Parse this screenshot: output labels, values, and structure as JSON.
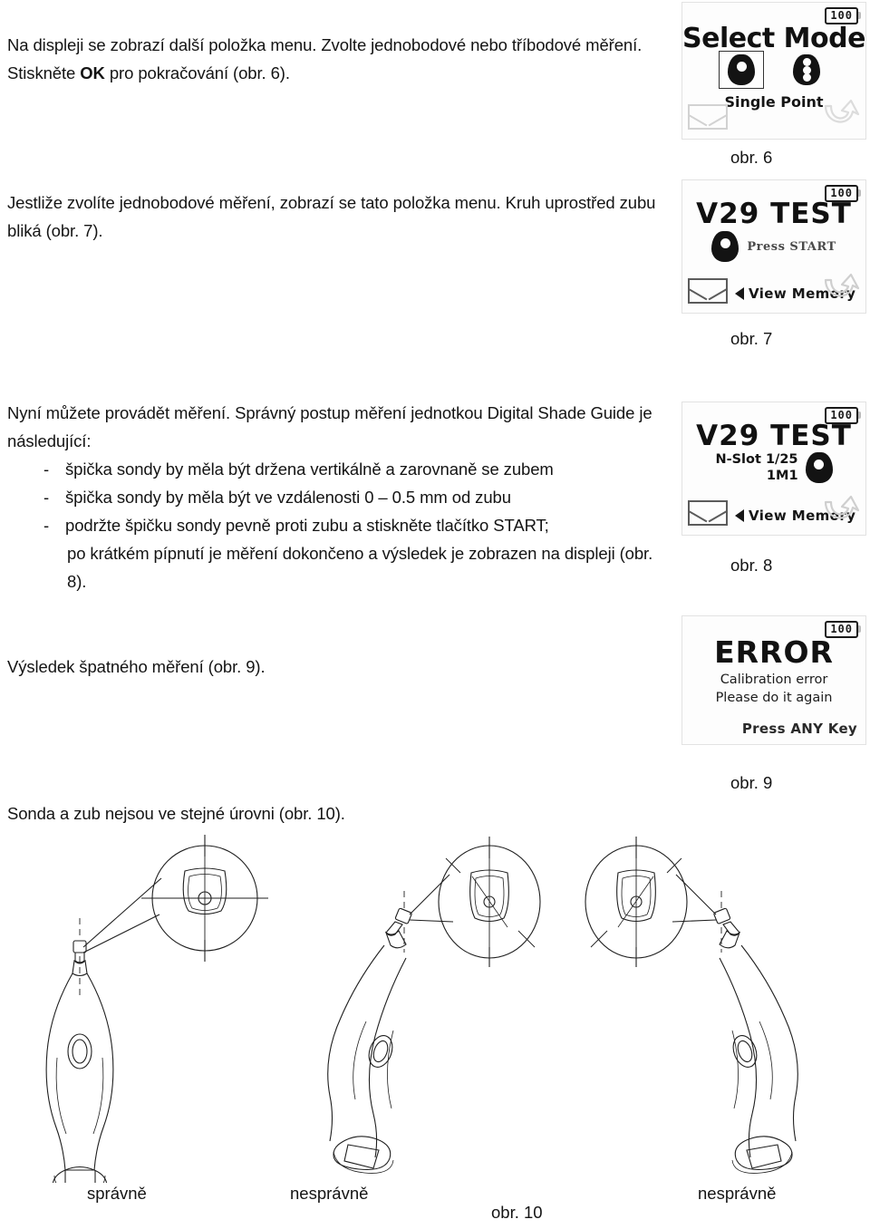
{
  "document": {
    "language": "cs",
    "paragraphs": {
      "p1_part1": "Na displeji se zobrazí další položka menu. Zvolte jednobodové nebo tříbodové měření. Stiskněte ",
      "p1_bold": "OK",
      "p1_part2": " pro pokračování (obr. 6).",
      "p2": "Jestliže zvolíte jednobodové měření, zobrazí se tato položka menu. Kruh uprostřed zubu bliká (obr. 7).",
      "p3_intro": "Nyní můžete provádět měření. Správný postup měření jednotkou Digital Shade Guide je následující:",
      "p4": "Výsledek špatného měření (obr. 9).",
      "p5": "Sonda a zub nejsou ve stejné úrovni (obr. 10)."
    },
    "bullets": {
      "dash": "-",
      "items": [
        {
          "line1": "špička sondy by měla být držena vertikálně a zarovnaně se zubem",
          "line2": ""
        },
        {
          "line1": "špička sondy by měla být ve vzdálenosti 0 – 0.5 mm od zubu",
          "line2": ""
        },
        {
          "line1": "podržte špičku sondy pevně proti zubu a stiskněte tlačítko START;",
          "line2": "po krátkém pípnutí je měření dokončeno a výsledek je zobrazen na displeji (obr. 8)."
        }
      ]
    }
  },
  "figures": {
    "fig6": {
      "caption": "obr. 6",
      "battery": "100",
      "title": "Select Mode",
      "mode_label": "Single Point",
      "icons": {
        "selected_tooth": "single-point-tooth-icon",
        "other_tooth": "three-point-tooth-icon",
        "envelope": "envelope-icon",
        "return": "return-arrow-icon"
      }
    },
    "fig7": {
      "caption": "obr. 7",
      "battery": "100",
      "title": "V29 TEST",
      "press_start": "Press START",
      "view_memory": "View Memory",
      "icons": {
        "tooth": "single-point-tooth-icon",
        "envelope": "envelope-icon",
        "return": "return-arrow-icon",
        "left_arrow": "triangle-left-icon"
      }
    },
    "fig8": {
      "caption": "obr. 8",
      "battery": "100",
      "title": "V29 TEST",
      "slot_line1": "N-Slot 1/25",
      "slot_line2": "1M1",
      "view_memory": "View Memory",
      "icons": {
        "tooth": "single-point-tooth-icon",
        "envelope": "envelope-icon",
        "return": "return-arrow-icon",
        "left_arrow": "triangle-left-icon"
      }
    },
    "fig9": {
      "caption": "obr. 9",
      "battery": "100",
      "title": "ERROR",
      "message_line1": "Calibration error",
      "message_line2": "Please do it again",
      "press_any_key": "Press ANY Key"
    },
    "fig10": {
      "caption": "obr. 10",
      "labels": [
        "správně",
        "nesprávně",
        "nesprávně"
      ],
      "description": "line-art drawings of the handheld probe against a tooth, with magnified circular insets showing probe-tip alignment"
    }
  },
  "colors": {
    "text": "#141414",
    "lcd_dark": "#131313",
    "lcd_background": "#fdfdfd",
    "lcd_border": "#e2e2e2",
    "muted": "#d2d2d2"
  }
}
